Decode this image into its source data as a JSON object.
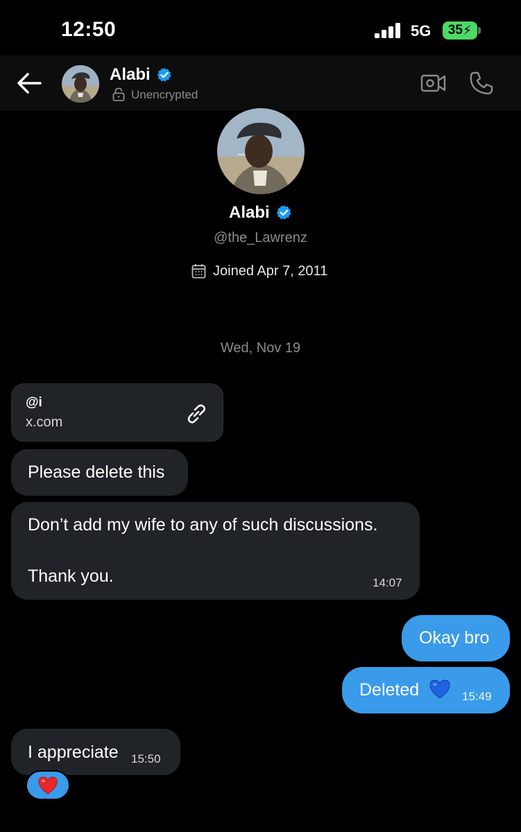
{
  "status_bar": {
    "time": "12:50",
    "network": "5G",
    "battery": "35"
  },
  "header": {
    "name": "Alabi",
    "status": "Unencrypted"
  },
  "profile": {
    "name": "Alabi",
    "handle": "@the_Lawrenz",
    "joined": "Joined Apr 7, 2011"
  },
  "date_separator": "Wed, Nov 19",
  "messages": [
    {
      "type": "link",
      "title": "@i",
      "domain": "x.com"
    },
    {
      "type": "text",
      "text": "Please delete this"
    },
    {
      "type": "text",
      "line1": "Don’t add my wife to any of such discussions.",
      "line2": "Thank you.",
      "time": "14:07"
    },
    {
      "type": "text",
      "text": "Okay bro"
    },
    {
      "type": "text",
      "text": "Deleted",
      "emoji": "blue-heart",
      "time": "15:49"
    },
    {
      "type": "text",
      "text": "I appreciate",
      "time": "15:50",
      "reaction": "red-heart"
    }
  ],
  "colors": {
    "outgoing_bubble": "#3a9bea",
    "incoming_bubble": "#202327",
    "verified": "#1d9bf0",
    "battery": "#4cd964"
  }
}
